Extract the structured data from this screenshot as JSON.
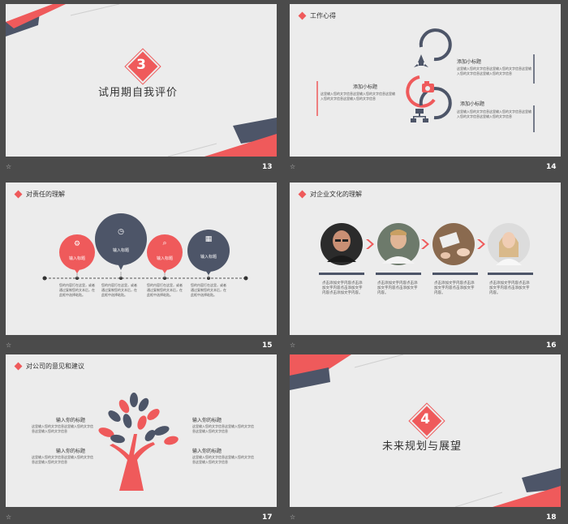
{
  "colors": {
    "accent": "#ef5a5b",
    "dark": "#4d5568",
    "slide_bg": "#ececec",
    "window_bg": "#4b4b4b"
  },
  "slides": [
    {
      "number": "13",
      "mark": "☆",
      "section_number": "3",
      "title": "试用期自我评价"
    },
    {
      "number": "14",
      "mark": "☆",
      "header": "工作心得",
      "items": [
        {
          "title": "添加小标题",
          "text": "这里输入您的文字信息这里输入您的文字信息这里输入您的文字信息这里输入您的文字信息"
        },
        {
          "title": "添加小标题",
          "text": "这里输入您的文字信息这里输入您的文字信息这里输入您的文字信息这里输入您的文字信息"
        },
        {
          "title": "添加小标题",
          "text": "这里输入您的文字信息这里输入您的文字信息这里输入您的文字信息这里输入您的文字信息"
        }
      ],
      "icons": [
        "rocket-icon",
        "camera-icon",
        "hierarchy-icon"
      ]
    },
    {
      "number": "15",
      "mark": "☆",
      "header": "对责任的理解",
      "bubbles": [
        {
          "label": "输入标题",
          "icon": "gear-icon"
        },
        {
          "label": "输入标题",
          "icon": "clock-icon"
        },
        {
          "label": "输入标题",
          "icon": "search-icon"
        },
        {
          "label": "输入标题",
          "icon": "cart-icon"
        }
      ],
      "texts": [
        "您的内容打在这里，或者通过复制您的文本后，在此框中选择粘贴。",
        "您的内容打在这里，或者通过复制您的文本后，在此框中选择粘贴。",
        "您的内容打在这里，或者通过复制您的文本后，在此框中选择粘贴。",
        "您的内容打在这里，或者通过复制您的文本后，在此框中选择粘贴。"
      ]
    },
    {
      "number": "16",
      "mark": "☆",
      "header": "对企业文化的理解",
      "texts": [
        "点击添加文字内容点击添加文字内容点击添加文字内容点击添加文字内容。",
        "点击添加文字内容点击添加文字内容点击添加文字内容。",
        "点击添加文字内容点击添加文字内容点击添加文字内容。",
        "点击添加文字内容点击添加文字内容点击添加文字内容。"
      ]
    },
    {
      "number": "17",
      "mark": "☆",
      "header": "对公司的意见和建议",
      "items": [
        {
          "title": "输入你的标题",
          "text": "这里输入您的文字信息这里输入您的文字信息这里输入您的文字信息"
        },
        {
          "title": "输入你的标题",
          "text": "这里输入您的文字信息这里输入您的文字信息这里输入您的文字信息"
        },
        {
          "title": "输入你的标题",
          "text": "这里输入您的文字信息这里输入您的文字信息这里输入您的文字信息"
        },
        {
          "title": "输入你的标题",
          "text": "这里输入您的文字信息这里输入您的文字信息这里输入您的文字信息"
        }
      ]
    },
    {
      "number": "18",
      "mark": "☆",
      "section_number": "4",
      "title": "未来规划与展望"
    }
  ]
}
